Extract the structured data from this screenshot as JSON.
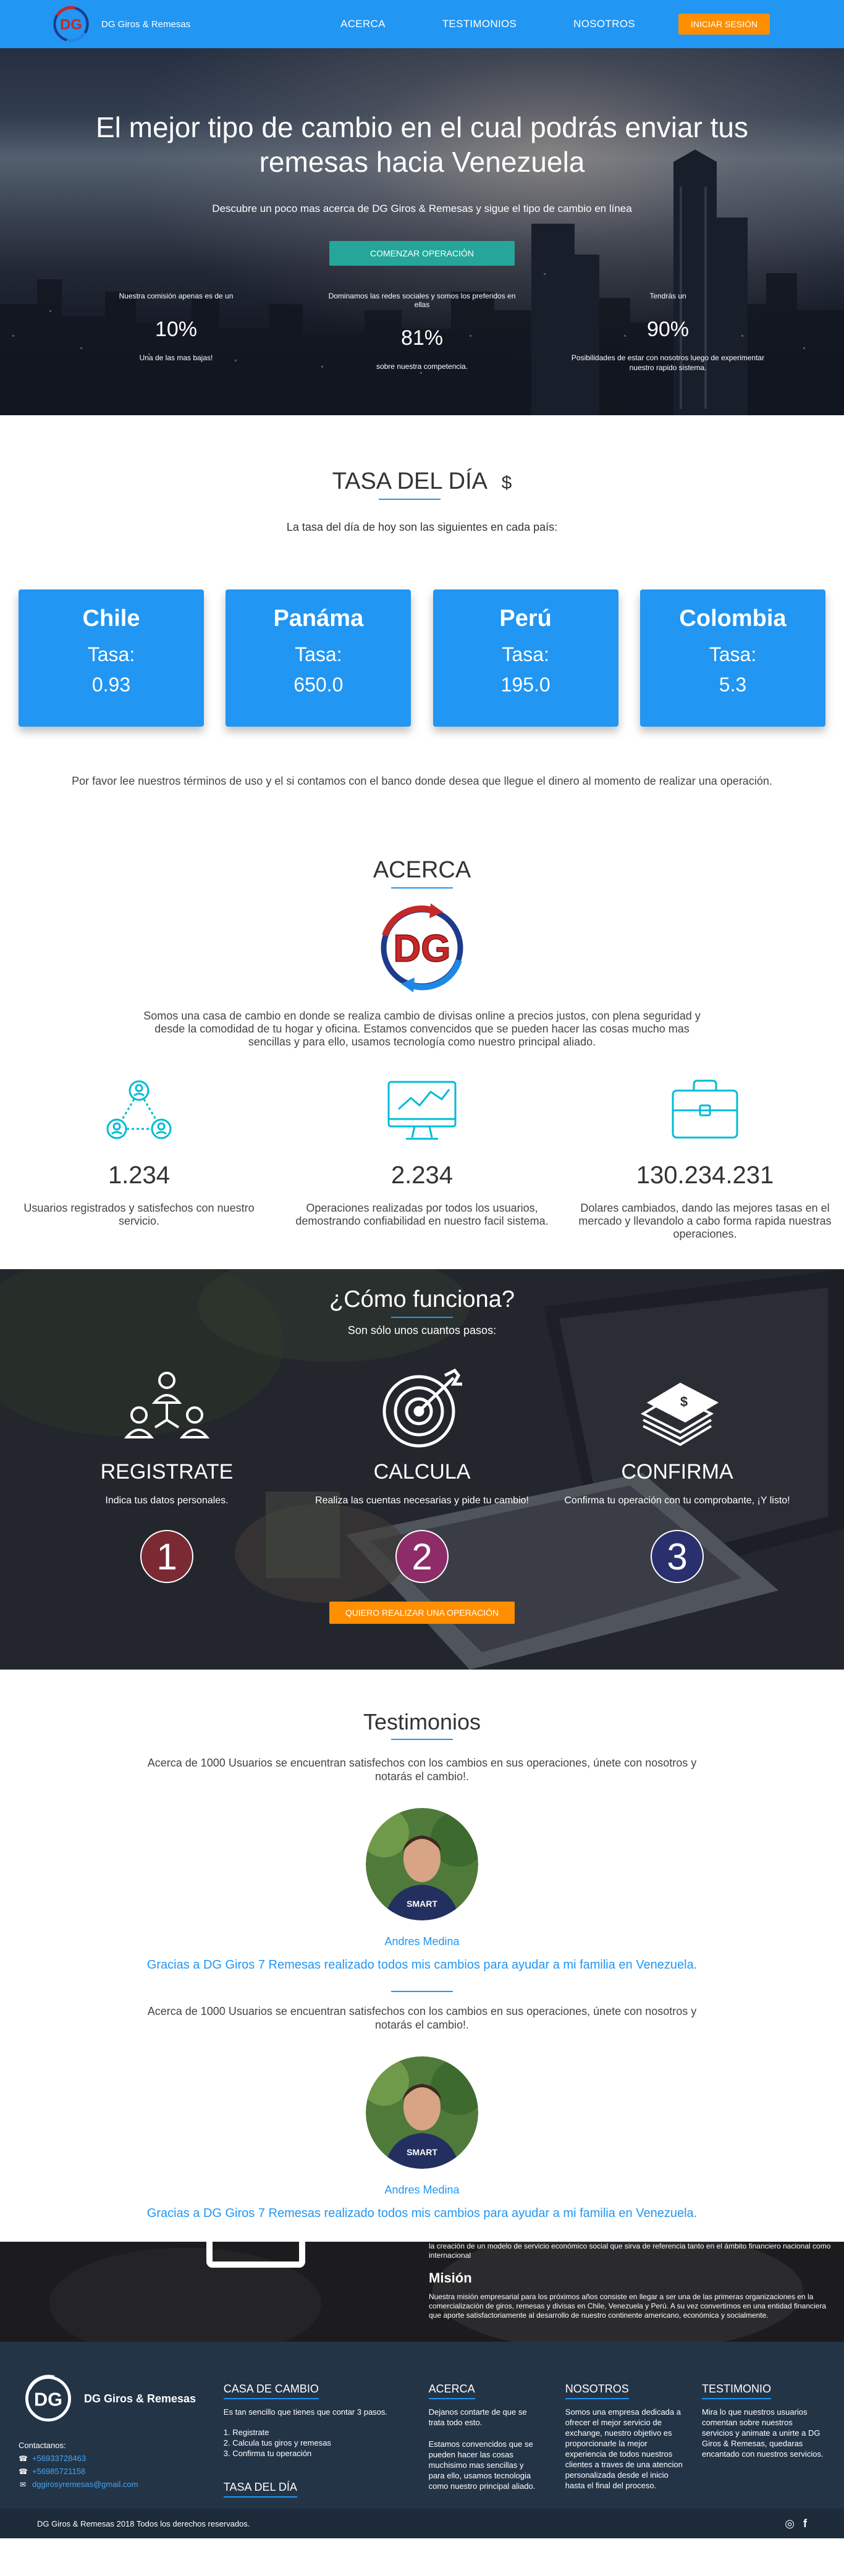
{
  "nav": {
    "brand": "DG Giros & Remesas",
    "links": [
      "ACERCA",
      "TESTIMONIOS",
      "NOSOTROS"
    ],
    "login": "INICIAR SESIÓN"
  },
  "hero": {
    "title": "El mejor tipo de cambio en el cual podrás enviar tus remesas hacia Venezuela",
    "subtitle": "Descubre un poco mas acerca de DG Giros & Remesas y sigue el tipo de cambio en línea",
    "cta": "COMENZAR OPERACIÓN",
    "stats": [
      {
        "top": "Nuestra comisión apenas es de un",
        "value": "10%",
        "bottom": "Una de las mas bajas!"
      },
      {
        "top": "Dominamos las redes sociales y somos los preferidos en ellas",
        "value": "81%",
        "bottom": "sobre nuestra competencia."
      },
      {
        "top": "Tendrás un",
        "value": "90%",
        "bottom": "Posibilidades de estar con nosotros luego de experimentar nuestro rapido sistema."
      }
    ]
  },
  "tasa": {
    "title": "TASA DEL DÍA",
    "dollar": "$",
    "subtitle": "La tasa del día de hoy son las siguientes en cada país:",
    "label": "Tasa:",
    "cards": [
      {
        "country": "Chile",
        "rate": "0.93"
      },
      {
        "country": "Panáma",
        "rate": "650.0"
      },
      {
        "country": "Perú",
        "rate": "195.0"
      },
      {
        "country": "Colombia",
        "rate": "5.3"
      }
    ],
    "note": "Por favor lee nuestros términos de uso y el si contamos con el banco donde desea que llegue el dinero al momento de realizar una operación."
  },
  "acerca": {
    "title": "ACERCA",
    "text": "Somos una casa de cambio en donde se realiza cambio de divisas online a precios justos, con plena seguridad y desde la comodidad de tu hogar y oficina. Estamos convencidos que se pueden hacer las cosas mucho mas sencillas y para ello, usamos tecnología como nuestro principal aliado.",
    "features": [
      {
        "icon": "users-network-icon",
        "number": "1.234",
        "text": "Usuarios registrados y satisfechos con nuestro servicio."
      },
      {
        "icon": "monitor-chart-icon",
        "number": "2.234",
        "text": "Operaciones realizadas por todos los usuarios, demostrando confiabilidad en nuestro facil sistema."
      },
      {
        "icon": "briefcase-icon",
        "number": "130.234.231",
        "text": "Dolares cambiados, dando las mejores tasas en el mercado y llevandolo a cabo forma rapida nuestras operaciones."
      }
    ]
  },
  "como": {
    "title": "¿Cómo funciona?",
    "subtitle": "Son sólo unos cuantos pasos:",
    "steps": [
      {
        "title": "REGISTRATE",
        "text": "Indica tus datos personales.",
        "num": "1",
        "color": "#7b2a33"
      },
      {
        "title": "CALCULA",
        "text": "Realiza las cuentas necesarias y pide tu cambio!",
        "num": "2",
        "color": "#8e2c6a"
      },
      {
        "title": "CONFIRMA",
        "text": "Confirma tu operación con tu comprobante, ¡Y listo!",
        "num": "3",
        "color": "#2a2f6e"
      }
    ],
    "cta": "QUIERO REALIZAR UNA OPERACIÓN"
  },
  "testimonios": {
    "title": "Testimonios",
    "items": [
      {
        "intro": "Acerca de 1000 Usuarios se encuentran satisfechos con los cambios en sus operaciones, únete con nosotros y notarás el cambio!.",
        "name": "Andres Medina",
        "quote": "Gracias a DG Giros 7 Remesas realizado todos mis cambios para ayudar a mi familia en Venezuela."
      },
      {
        "intro": "Acerca de 1000 Usuarios se encuentran satisfechos con los cambios en sus operaciones, únete con nosotros y notarás el cambio!.",
        "name": "Andres Medina",
        "quote": "Gracias a DG Giros 7 Remesas realizado todos mis cambios para ayudar a mi familia en Venezuela."
      }
    ]
  },
  "mision": {
    "top": "la creación de un modelo de servicio económico social que sirva de referencia tanto en el ámbito financiero nacional como internacional",
    "title": "Misión",
    "text": "Nuestra misión empresarial para los próximos años consiste en llegar a ser una de las primeras organizaciones en la comercialización de giros, remesas y divisas en Chile, Venezuela y Perú. A su vez convertirnos en una entidad financiera que aporte satisfactoriamente al desarrollo de nuestro continente americano, económica y socialmente."
  },
  "footer": {
    "brand": "DG Giros & Remesas",
    "contact_title": "Contactanos:",
    "contacts": [
      {
        "icon": "phone-icon",
        "text": "+56933728463"
      },
      {
        "icon": "phone-icon",
        "text": "+56985721158"
      },
      {
        "icon": "mail-icon",
        "text": "dggirosyremesas@gmail.com"
      }
    ],
    "casa": {
      "title": "CASA DE CAMBIO",
      "text": "Es tan sencillo que tienes que contar 3 pasos.",
      "steps": [
        "1. Registrate",
        "2. Calcula tus giros y remesas",
        "3. Confirma tu operación"
      ],
      "tasa_title": "TASA DEL DÍA"
    },
    "acerca": {
      "title": "ACERCA",
      "text1": "Dejanos contarte de que se trata todo esto.",
      "text2": "Estamos convencidos que se pueden hacer las cosas muchisimo mas sencillas y para ello, usamos tecnologia como nuestro principal aliado."
    },
    "nosotros": {
      "title": "NOSOTROS",
      "text": "Somos una empresa dedicada a ofrecer el mejor servicio de exchange, nuestro objetivo es proporcionarle la mejor experiencia de todos nuestros clientes a traves de una atencion personalizada desde el inicio hasta el final del proceso."
    },
    "testimonio": {
      "title": "TESTIMONIO",
      "text": "Mira lo que nuestros usuarios comentan sobre nuestros servicios y animate a unirte a DG Giros & Remesas, quedaras encantado con nuestros servicios."
    },
    "copyright": "DG Giros & Remesas 2018 Todos los derechos reservados.",
    "social": [
      "instagram-icon",
      "facebook-icon"
    ]
  },
  "colors": {
    "primary": "#2196f3",
    "accent": "#ff8f00",
    "teal": "#26a69a",
    "footer": "#243447",
    "feature_icon": "#00bcd4"
  }
}
